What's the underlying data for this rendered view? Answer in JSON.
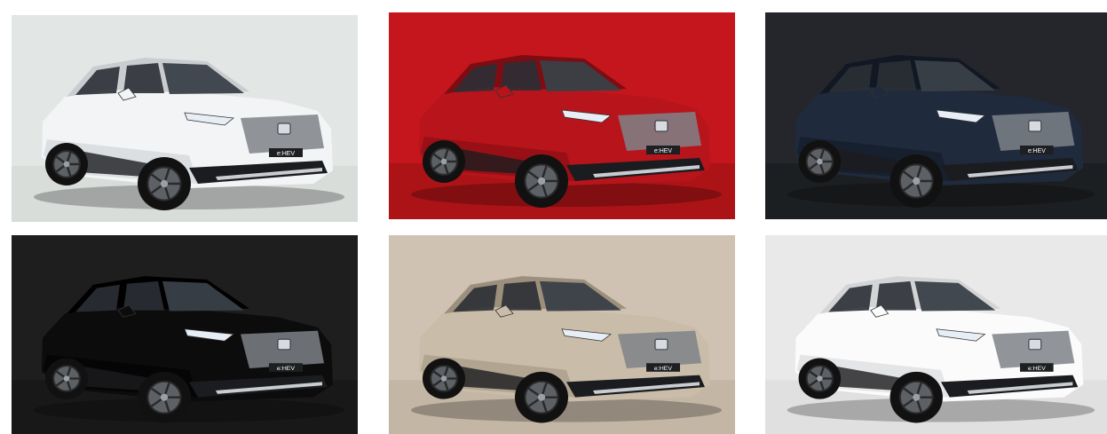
{
  "gallery": {
    "tiles": [
      {
        "background": "#e2e6e4",
        "floor": "#d4d8d6",
        "body_color": "#f3f4f5",
        "shade_color": "#c9cdd0"
      },
      {
        "background": "#c4161c",
        "floor": "#a31216",
        "body_color": "#b8141b",
        "shade_color": "#7d0d12"
      },
      {
        "background": "#24262b",
        "floor": "#1a1c20",
        "body_color": "#1f2a3d",
        "shade_color": "#111824"
      },
      {
        "background": "#1e1e1e",
        "floor": "#151515",
        "body_color": "#0c0c0c",
        "shade_color": "#000000"
      },
      {
        "background": "#cfc2b3",
        "floor": "#bdb0a0",
        "body_color": "#c9bca8",
        "shade_color": "#9c8f7c"
      },
      {
        "background": "#e9e9e9",
        "floor": "#dcdcdc",
        "body_color": "#fbfbfb",
        "shade_color": "#d2d4d6"
      }
    ],
    "grille_badge": "e:HEV"
  }
}
